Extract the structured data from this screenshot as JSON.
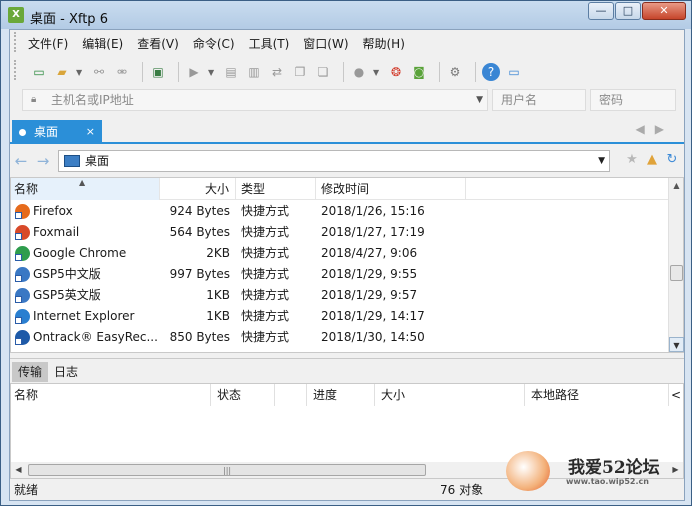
{
  "window": {
    "title": "桌面 - Xftp 6",
    "app_icon_letter": "X"
  },
  "caption": {
    "minimize": "—",
    "maximize": "□",
    "close": "✕"
  },
  "menu": [
    "文件(F)",
    "编辑(E)",
    "查看(V)",
    "命令(C)",
    "工具(T)",
    "窗口(W)",
    "帮助(H)"
  ],
  "toolbar_icons": [
    "new-session-icon",
    "open-folder-icon",
    "connect-icon",
    "disconnect-icon",
    "new-window-icon",
    "transfer-icon",
    "copy-icon",
    "paste-icon",
    "sync-icon",
    "page-copy-icon",
    "page-paste-icon",
    "status-icon",
    "xshell-icon",
    "xftp-icon",
    "settings-icon",
    "help-icon",
    "chat-icon"
  ],
  "address": {
    "host_placeholder": "主机名或IP地址",
    "user_placeholder": "用户名",
    "pass_placeholder": "密码"
  },
  "tab": {
    "label": "桌面",
    "close": "×"
  },
  "path": {
    "current": "桌面"
  },
  "file_list": {
    "columns": {
      "name": "名称",
      "size": "大小",
      "type": "类型",
      "modified": "修改时间"
    },
    "rows": [
      {
        "name": "Firefox",
        "size": "924 Bytes",
        "type": "快捷方式",
        "modified": "2018/1/26, 15:16",
        "icon_color": "#e66b1c"
      },
      {
        "name": "Foxmail",
        "size": "564 Bytes",
        "type": "快捷方式",
        "modified": "2018/1/27, 17:19",
        "icon_color": "#d84a2a"
      },
      {
        "name": "Google Chrome",
        "size": "2KB",
        "type": "快捷方式",
        "modified": "2018/4/27, 9:06",
        "icon_color": "#2f9d4d"
      },
      {
        "name": "GSP5中文版",
        "size": "997 Bytes",
        "type": "快捷方式",
        "modified": "2018/1/29, 9:55",
        "icon_color": "#3a78c4"
      },
      {
        "name": "GSP5英文版",
        "size": "1KB",
        "type": "快捷方式",
        "modified": "2018/1/29, 9:57",
        "icon_color": "#3a78c4"
      },
      {
        "name": "Internet Explorer",
        "size": "1KB",
        "type": "快捷方式",
        "modified": "2018/1/29, 14:17",
        "icon_color": "#2a7fd0"
      },
      {
        "name": "Ontrack® EasyRec...",
        "size": "850 Bytes",
        "type": "快捷方式",
        "modified": "2018/1/30, 14:50",
        "icon_color": "#1e5aa8"
      }
    ]
  },
  "transfer": {
    "tabs": [
      "传输",
      "日志"
    ],
    "columns": {
      "name": "名称",
      "status": "状态",
      "progress": "进度",
      "size": "大小",
      "local_path": "本地路径",
      "more": "<"
    }
  },
  "status": {
    "left": "就绪",
    "count": "76 对象"
  },
  "watermark": {
    "title": "我爱52论坛",
    "url": "www.tao.wip52.cn"
  }
}
